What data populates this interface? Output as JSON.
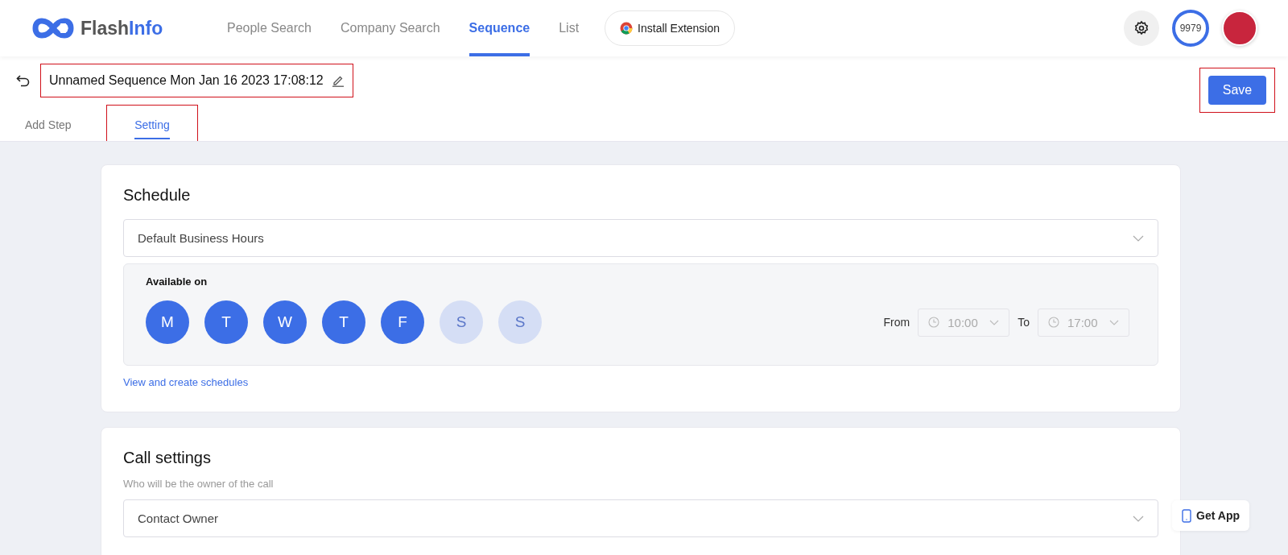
{
  "header": {
    "logo": {
      "first": "Flash",
      "second": "Info"
    },
    "nav": [
      {
        "label": "People Search",
        "selected": false
      },
      {
        "label": "Company Search",
        "selected": false
      },
      {
        "label": "Sequence",
        "selected": true
      },
      {
        "label": "List",
        "selected": false
      }
    ],
    "extension_button": "Install Extension",
    "credits": "9979"
  },
  "title_bar": {
    "title": "Unnamed Sequence Mon Jan 16 2023 17:08:12",
    "highlighted": true,
    "save": "Save",
    "save_highlighted": true
  },
  "tabs": [
    {
      "label": "Add Step",
      "selected": false,
      "highlighted": false
    },
    {
      "label": "Setting",
      "selected": true,
      "highlighted": true
    }
  ],
  "schedule": {
    "heading": "Schedule",
    "select_value": "Default Business Hours",
    "available_label": "Available on",
    "days": [
      {
        "label": "M",
        "selected": true
      },
      {
        "label": "T",
        "selected": true
      },
      {
        "label": "W",
        "selected": true
      },
      {
        "label": "T",
        "selected": true
      },
      {
        "label": "F",
        "selected": true
      },
      {
        "label": "S",
        "selected": false
      },
      {
        "label": "S",
        "selected": false
      }
    ],
    "from_label": "From",
    "from_value": "10:00",
    "to_label": "To",
    "to_value": "17:00",
    "times_disabled": true,
    "link": "View and create schedules"
  },
  "call_settings": {
    "heading": "Call settings",
    "hint": "Who will be the owner of the call",
    "select_value": "Contact Owner"
  },
  "get_app": "Get App"
}
